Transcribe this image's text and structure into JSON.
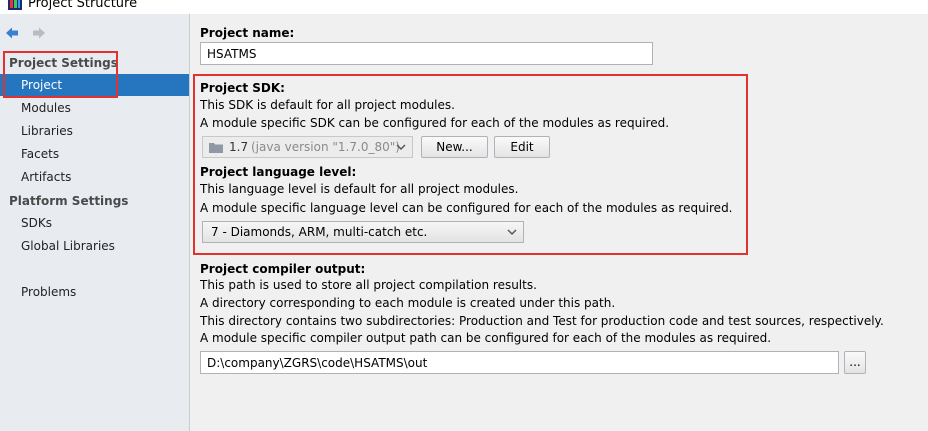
{
  "window": {
    "title": "Project Structure"
  },
  "sidebar": {
    "project_settings_header": "Project Settings",
    "project_items": [
      "Project",
      "Modules",
      "Libraries",
      "Facets",
      "Artifacts"
    ],
    "platform_settings_header": "Platform Settings",
    "platform_items": [
      "SDKs",
      "Global Libraries"
    ],
    "problems": "Problems",
    "selected": "Project"
  },
  "project_name": {
    "label": "Project name:",
    "value": "HSATMS"
  },
  "sdk": {
    "label": "Project SDK:",
    "desc1": "This SDK is default for all project modules.",
    "desc2": "A module specific SDK can be configured for each of the modules as required.",
    "combo_version": "1.7",
    "combo_detail": "(java version \"1.7.0_80\")",
    "new_button": "New...",
    "edit_button": "Edit"
  },
  "language_level": {
    "label": "Project language level:",
    "desc1": "This language level is default for all project modules.",
    "desc2": "A module specific language level can be configured for each of the modules as required.",
    "value": "7 - Diamonds, ARM, multi-catch etc."
  },
  "compiler_output": {
    "label": "Project compiler output:",
    "desc1": "This path is used to store all project compilation results.",
    "desc2": "A directory corresponding to each module is created under this path.",
    "desc3": "This directory contains two subdirectories: Production and Test for production code and test sources, respectively.",
    "desc4": "A module specific compiler output path can be configured for each of the modules as required.",
    "path": "D:\\company\\ZGRS\\code\\HSATMS\\out",
    "browse_button": "..."
  },
  "colors": {
    "selection": "#2675bf",
    "highlight_box": "#e0322e",
    "sidebar_bg": "#e8ecf1",
    "panel_bg": "#f0f0f0"
  },
  "icons": [
    "app-icon",
    "back-arrow-icon",
    "forward-arrow-icon",
    "folder-icon",
    "chevron-down-icon"
  ]
}
